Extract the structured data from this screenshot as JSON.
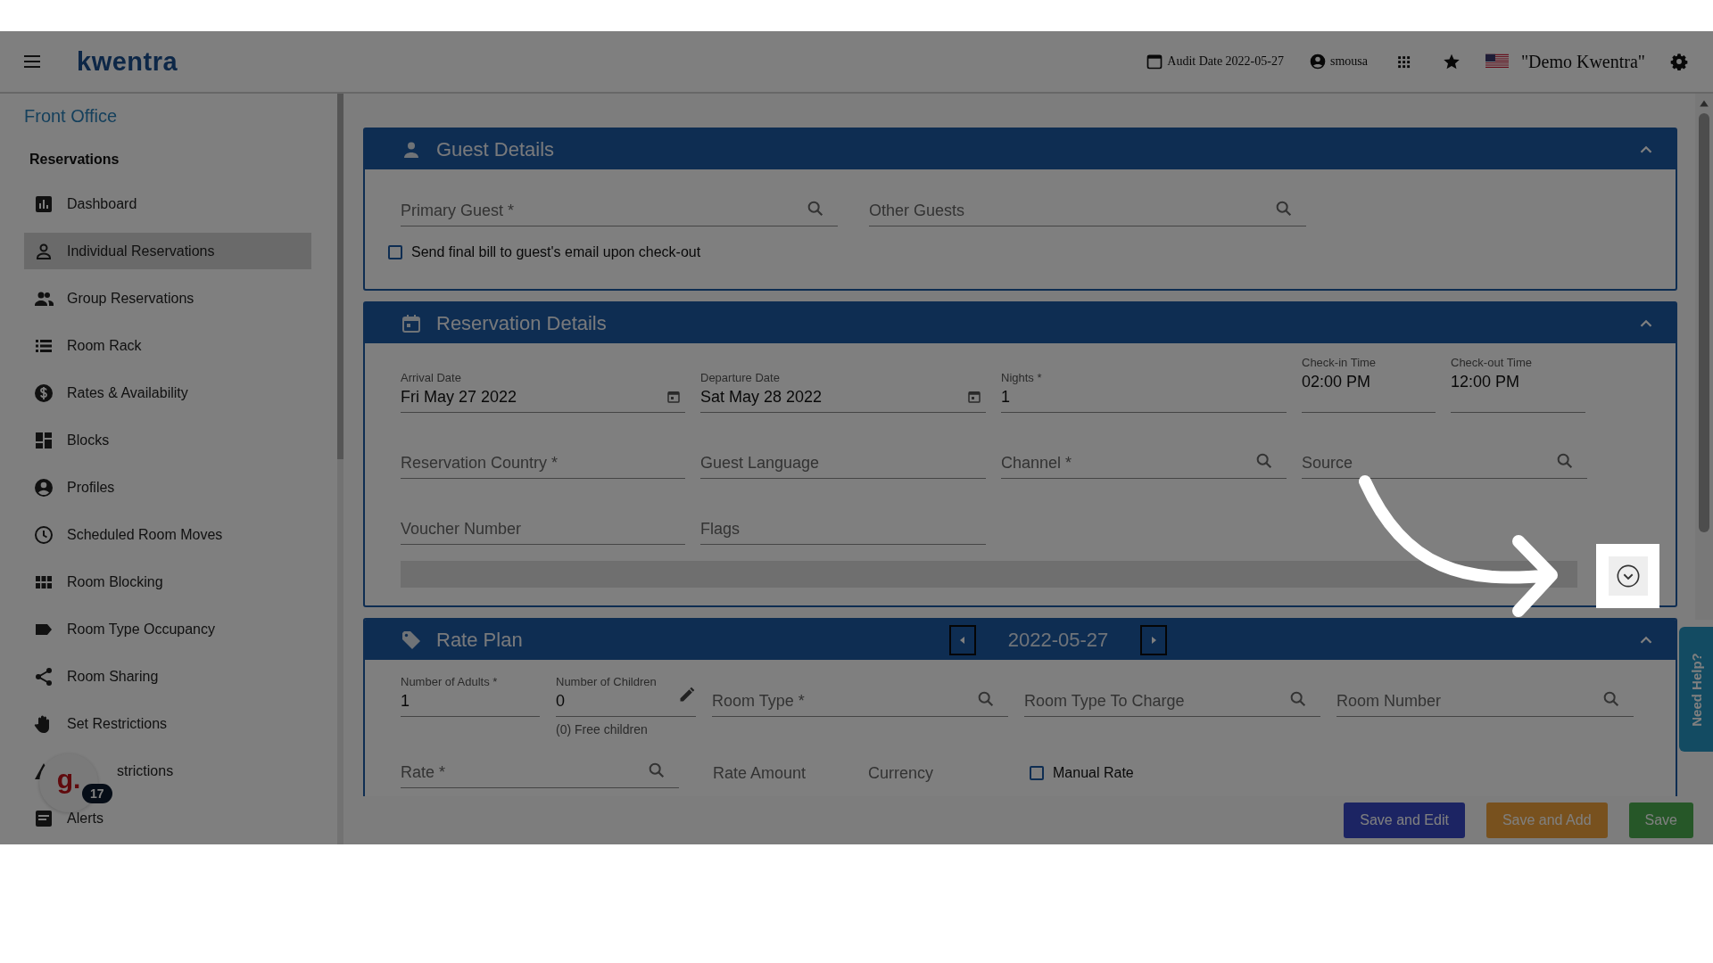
{
  "header": {
    "logo": "kwentra",
    "audit_date": "Audit Date 2022-05-27",
    "user": "smousa",
    "property": "\"Demo Kwentra\""
  },
  "sidebar": {
    "title": "Front Office",
    "section": "Reservations",
    "items": [
      {
        "label": "Dashboard",
        "selected": false
      },
      {
        "label": "Individual Reservations",
        "selected": true
      },
      {
        "label": "Group Reservations",
        "selected": false
      },
      {
        "label": "Room Rack",
        "selected": false
      },
      {
        "label": "Rates & Availability",
        "selected": false
      },
      {
        "label": "Blocks",
        "selected": false
      },
      {
        "label": "Profiles",
        "selected": false
      },
      {
        "label": "Scheduled Room Moves",
        "selected": false
      },
      {
        "label": "Room Blocking",
        "selected": false
      },
      {
        "label": "Room Type Occupancy",
        "selected": false
      },
      {
        "label": "Room Sharing",
        "selected": false
      },
      {
        "label": "Set Restrictions",
        "selected": false
      },
      {
        "label": "strictions",
        "selected": false
      },
      {
        "label": "Alerts",
        "selected": false
      }
    ]
  },
  "guest_details": {
    "title": "Guest Details",
    "expanded": true,
    "fields": [
      {
        "label": "Primary Guest *",
        "kind": "search"
      },
      {
        "label": "Other Guests",
        "kind": "search"
      }
    ],
    "checkbox": {
      "label": "Send final bill to guest's email upon check-out",
      "checked": false
    }
  },
  "reservation_details": {
    "title": "Reservation Details",
    "expanded": true,
    "fields": [
      {
        "label": "Arrival Date",
        "value": "Fri May 27 2022",
        "kind": "date"
      },
      {
        "label": "Departure Date",
        "value": "Sat May 28 2022",
        "kind": "date"
      },
      {
        "label": "Nights *",
        "value": "1",
        "kind": "text"
      },
      {
        "label": "Check-in Time",
        "value": "02:00 PM",
        "kind": "time"
      },
      {
        "label": "Check-out Time",
        "value": "12:00 PM",
        "kind": "time"
      },
      {
        "label": "Reservation Country *",
        "kind": "text"
      },
      {
        "label": "Guest Language",
        "kind": "text"
      },
      {
        "label": "Channel *",
        "kind": "search"
      },
      {
        "label": "Source",
        "kind": "search"
      },
      {
        "label": "Voucher Number",
        "kind": "text"
      },
      {
        "label": "Flags",
        "kind": "text"
      }
    ]
  },
  "rate_plan": {
    "title": "Rate Plan",
    "date": "2022-05-27",
    "expanded": true,
    "fields": [
      {
        "label": "Number of Adults *",
        "value": "1",
        "kind": "text"
      },
      {
        "label": "Number of Children",
        "value": "0",
        "kind": "edit",
        "hint": "(0) Free children"
      },
      {
        "label": "Room Type *",
        "kind": "search"
      },
      {
        "label": "Room Type To Charge",
        "kind": "search"
      },
      {
        "label": "Room Number",
        "kind": "search"
      },
      {
        "label": "Rate *",
        "kind": "search"
      },
      {
        "label": "Rate Amount",
        "kind": "plain"
      },
      {
        "label": "Currency",
        "kind": "plain"
      },
      {
        "label": "Manual Rate",
        "kind": "checkbox",
        "checked": false
      }
    ]
  },
  "widget": {
    "logo": "g.",
    "badge": "17"
  },
  "need_help": "Need Help?",
  "actions": [
    {
      "label": "Save and Edit",
      "kind": "edit"
    },
    {
      "label": "Save and Add",
      "kind": "add"
    },
    {
      "label": "Save",
      "kind": "save"
    }
  ]
}
